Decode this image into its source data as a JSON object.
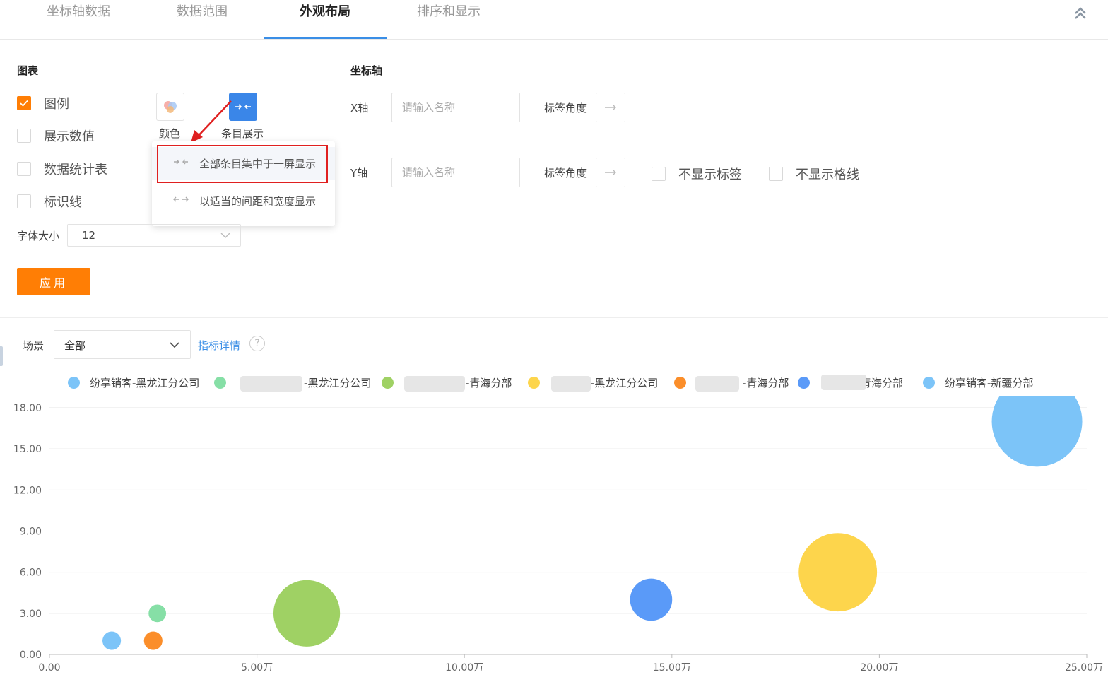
{
  "tabs": [
    {
      "label": "坐标轴数据",
      "active": false
    },
    {
      "label": "数据范围",
      "active": false
    },
    {
      "label": "外观布局",
      "active": true
    },
    {
      "label": "排序和显示",
      "active": false
    }
  ],
  "chart_panel": {
    "title": "图表",
    "checkboxes": [
      {
        "label": "图例",
        "checked": true
      },
      {
        "label": "展示数值",
        "checked": false
      },
      {
        "label": "数据统计表",
        "checked": false
      },
      {
        "label": "标识线",
        "checked": false
      }
    ],
    "color_button_label": "颜色",
    "entry_display_label": "条目展示",
    "dropdown": {
      "items": [
        {
          "label": "全部条目集中于一屏显示",
          "selected": true
        },
        {
          "label": "以适当的间距和宽度显示",
          "selected": false
        }
      ]
    },
    "font_size_label": "字体大小",
    "font_size_value": "12",
    "apply_label": "应用"
  },
  "axis_panel": {
    "title": "坐标轴",
    "x_label": "X轴",
    "y_label": "Y轴",
    "name_placeholder": "请输入名称",
    "label_angle": "标签角度",
    "hide_labels": "不显示标签",
    "hide_gridlines": "不显示格线"
  },
  "scene": {
    "label": "场景",
    "value": "全部",
    "metric_details": "指标详情"
  },
  "colors": {
    "accent": "#ff7e05",
    "link": "#3a8ee6",
    "highlight_box": "#e02020"
  },
  "legend": [
    {
      "text": "纷享销客-黑龙江分公司",
      "color": "#7cc4f8"
    },
    {
      "text": "-黑龙江分公司",
      "color": "#86dfa6"
    },
    {
      "text": "-青海分部",
      "color": "#9fd164"
    },
    {
      "text": "-黑龙江分公司",
      "color": "#fdd54c"
    },
    {
      "text": "-青海分部",
      "color": "#fb8e2a"
    },
    {
      "text": "青海分部",
      "color": "#5a9af8"
    },
    {
      "text": "纷享销客-新疆分部",
      "color": "#7cc4f8"
    }
  ],
  "chart_data": {
    "type": "bubble",
    "x_ticks": [
      "0.00",
      "5.00万",
      "10.00万",
      "15.00万",
      "20.00万",
      "25.00万"
    ],
    "y_ticks": [
      "0.00",
      "3.00",
      "6.00",
      "9.00",
      "12.00",
      "15.00",
      "18.00"
    ],
    "xlim": [
      0,
      250000
    ],
    "ylim": [
      0,
      18
    ],
    "grid": true,
    "points": [
      {
        "x": 15000,
        "y": 1,
        "size": 1,
        "color": "#7cc4f8"
      },
      {
        "x": 26000,
        "y": 3,
        "size": 0.9,
        "color": "#86dfa6"
      },
      {
        "x": 62000,
        "y": 3,
        "size": 13,
        "color": "#9fd164"
      },
      {
        "x": 190000,
        "y": 6,
        "size": 18,
        "color": "#fdd54c"
      },
      {
        "x": 25000,
        "y": 1,
        "size": 1,
        "color": "#fb8e2a"
      },
      {
        "x": 145000,
        "y": 4,
        "size": 5.2,
        "color": "#5a9af8"
      },
      {
        "x": 238000,
        "y": 17,
        "size": 24,
        "color": "#7cc4f8"
      }
    ]
  }
}
